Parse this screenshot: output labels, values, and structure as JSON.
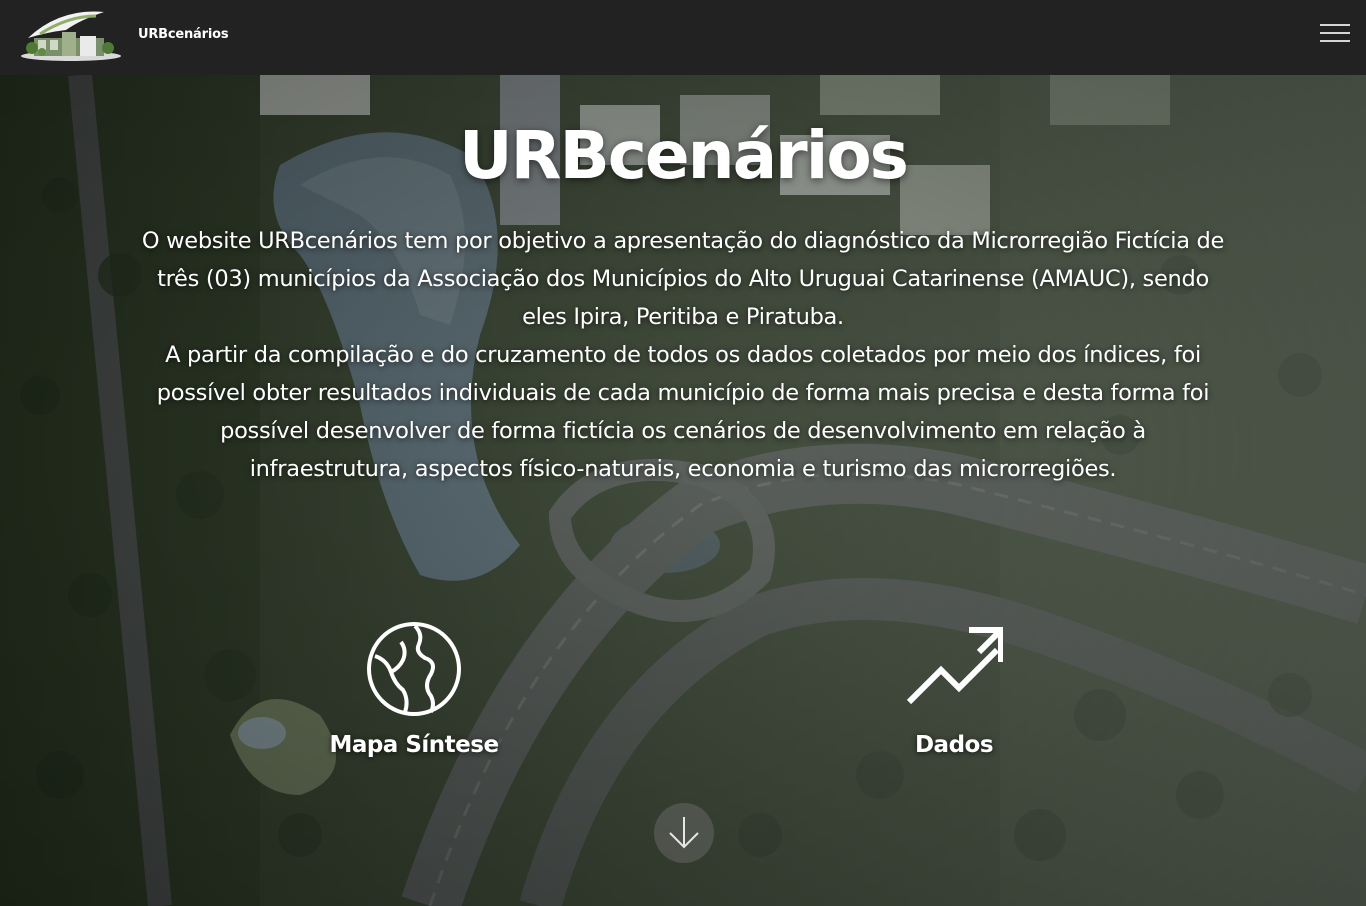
{
  "header": {
    "brand": "URBcenários",
    "menu_icon": "hamburger-icon",
    "logo_icon": "building-logo"
  },
  "hero": {
    "title": "URBcenários",
    "description": "O website URBcenários tem por objetivo a apresentação do diagnóstico da Microrregião Fictícia de três (03) municípios da Associação dos Municípios do Alto Uruguai Catarinense (AMAUC), sendo eles Ipira, Peritiba e Piratuba.\nA partir da compilação e do cruzamento de todos os dados coletados por meio dos índices, foi possível obter resultados individuais de cada município de forma mais precisa e desta forma foi possível desenvolver de forma fictícia  os cenários de desenvolvimento em relação à infraestrutura, aspectos físico-naturais, economia e turismo das microrregiões."
  },
  "features": [
    {
      "label": "Mapa Síntese",
      "icon": "globe-map-icon"
    },
    {
      "label": "Dados",
      "icon": "trending-up-icon"
    }
  ],
  "scroll": {
    "icon": "arrow-down-icon"
  },
  "colors": {
    "topbar": "#222222",
    "text": "#ffffff",
    "menu_lines": "#d6d6d6"
  }
}
